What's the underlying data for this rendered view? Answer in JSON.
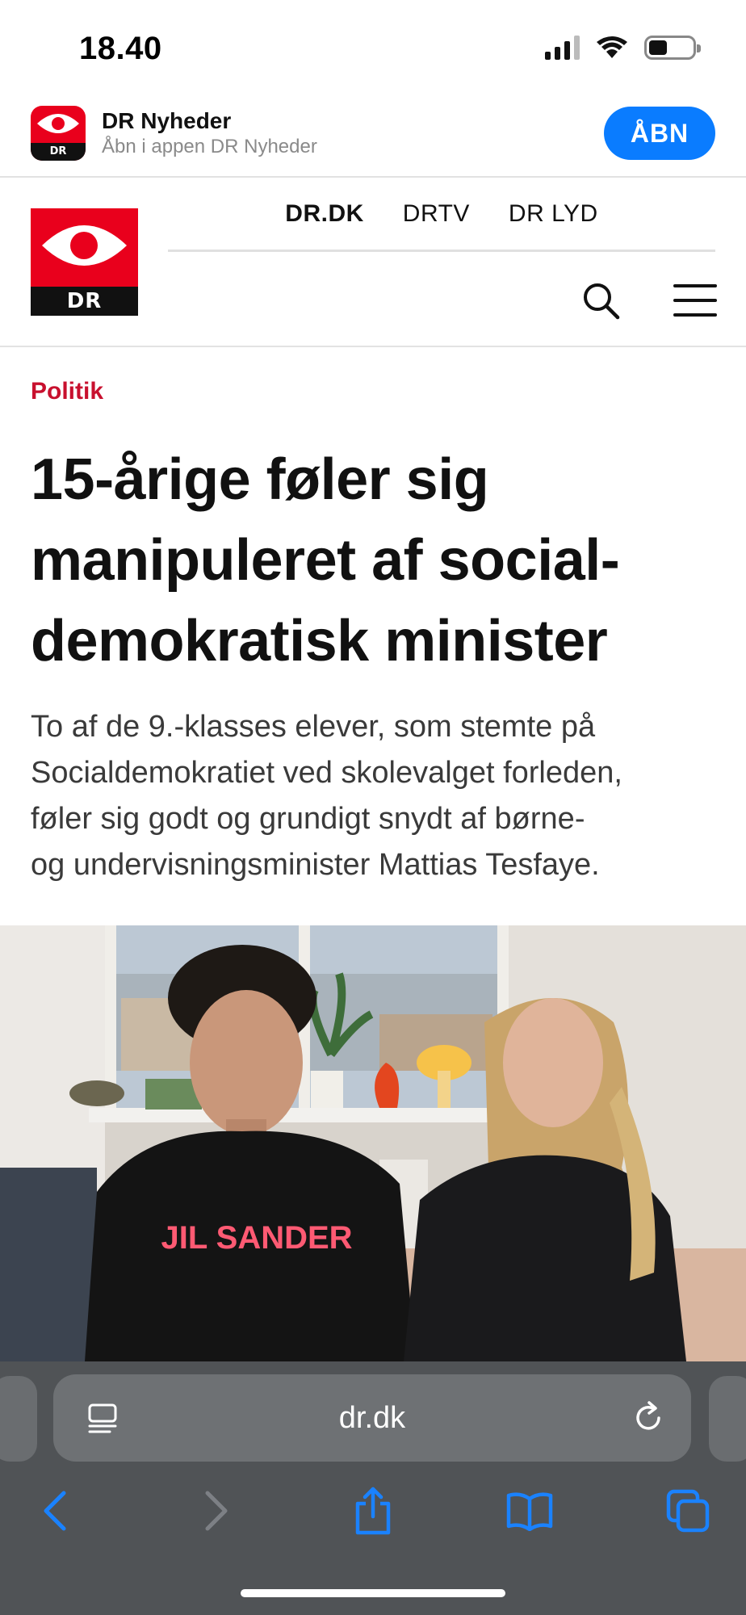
{
  "status": {
    "time": "18.40",
    "battery_level": 0.42
  },
  "app_banner": {
    "icon_label": "DR",
    "title": "DR Nyheder",
    "subtitle": "Åbn i appen DR Nyheder",
    "open_label": "ÅBN"
  },
  "header": {
    "logo_text": "DR",
    "nav": [
      {
        "label": "DR.DK",
        "active": true
      },
      {
        "label": "DRTV",
        "active": false
      },
      {
        "label": "DR LYD",
        "active": false
      }
    ],
    "icons": [
      "search-icon",
      "menu-icon"
    ]
  },
  "article": {
    "section": "Politik",
    "headline_lines": [
      "15-årige føler sig",
      "manipuleret af social-",
      "demokratisk minister"
    ],
    "lead_lines": [
      "To af de 9.-klasses elever, som stemte på",
      "Socialdemokratiet ved skolevalget forleden,",
      "føler sig godt og grundigt snydt af børne-",
      "og undervisningsminister Mattias Tesfaye."
    ],
    "photo_shirt_text": "JIL SANDER"
  },
  "browser": {
    "url": "dr.dk",
    "toolbar": [
      "back-icon",
      "forward-icon",
      "share-icon",
      "bookmarks-icon",
      "tabs-icon"
    ]
  },
  "colors": {
    "dr_red": "#e9001c",
    "kicker_red": "#c8102e",
    "ios_blue": "#0a7cff",
    "browser_bg": "#505356"
  }
}
